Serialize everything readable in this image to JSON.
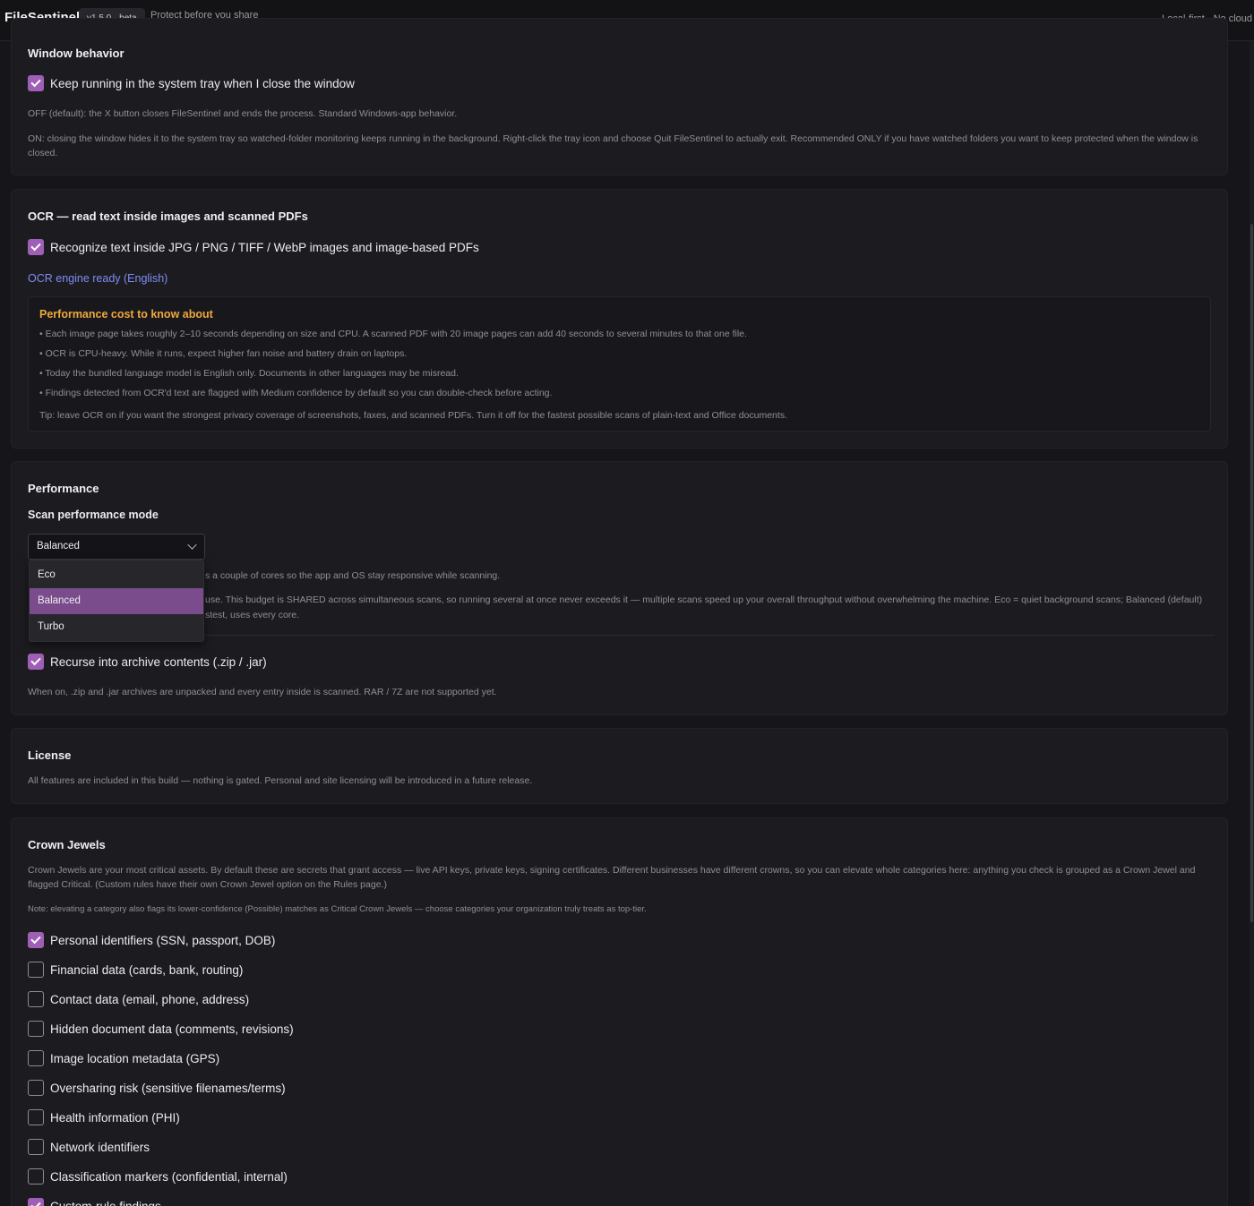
{
  "header": {
    "app_name": "FileSentinel",
    "version": "v1.5.0 · beta",
    "tagline": "Protect before you share",
    "right_text": "Local-first · No cloud"
  },
  "window_behavior": {
    "title": "Window behavior",
    "tray_label": "Keep running in the system tray when I close the window",
    "tray_checked": true,
    "desc_off": "OFF (default): the X button closes FileSentinel and ends the process. Standard Windows-app behavior.",
    "desc_on": "ON: closing the window hides it to the system tray so watched-folder monitoring keeps running in the background. Right-click the tray icon and choose Quit FileSentinel to actually exit. Recommended ONLY if you have watched folders you want to keep protected when the window is closed."
  },
  "ocr": {
    "title": "OCR — read text inside images and scanned PDFs",
    "enable_label": "Recognize text inside JPG / PNG / TIFF / WebP images and image-based PDFs",
    "enable_checked": true,
    "status": "OCR engine ready (English)",
    "callout_title": "Performance cost to know about",
    "bullets": [
      "• Each image page takes roughly 2–10 seconds depending on size and CPU. A scanned PDF with 20 image pages can add 40 seconds to several minutes to that one file.",
      "• OCR is CPU-heavy. While it runs, expect higher fan noise and battery drain on laptops.",
      "• Today the bundled language model is English only. Documents in other languages may be misread.",
      "• Findings detected from OCR'd text are flagged with Medium confidence by default so you can double-check before acting."
    ],
    "tip": "Tip: leave OCR on if you want the strongest privacy coverage of screenshots, faxes, and scanned PDFs. Turn it off for the fastest possible scans of plain-text and Office documents."
  },
  "performance": {
    "title": "Performance",
    "mode_label": "Scan performance mode",
    "selected": "Balanced",
    "options": [
      "Eco",
      "Balanced",
      "Turbo"
    ],
    "desc_line1_visible": "s a couple of cores so the app and OS stay responsive while scanning.",
    "desc_line2_visible": "use. This budget is SHARED across simultaneous scans, so running several at once never exceeds it — multiple scans speed up your overall throughput without overwhelming the machine. Eco = quiet background scans; Balanced (default)",
    "desc_line3_visible": "stest, uses every core.",
    "archive_label": "Recurse into archive contents (.zip / .jar)",
    "archive_checked": true,
    "archive_desc": "When on, .zip and .jar archives are unpacked and every entry inside is scanned. RAR / 7Z are not supported yet."
  },
  "license": {
    "title": "License",
    "desc": "All features are included in this build — nothing is gated. Personal and site licensing will be introduced in a future release."
  },
  "crown_jewels": {
    "title": "Crown Jewels",
    "desc": "Crown Jewels are your most critical assets. By default these are secrets that grant access — live API keys, private keys, signing certificates. Different businesses have different crowns, so you can elevate whole categories here: anything you check is grouped as a Crown Jewel and flagged Critical. (Custom rules have their own Crown Jewel option on the Rules page.)",
    "note": "Note: elevating a category also flags its lower-confidence (Possible) matches as Critical Crown Jewels — choose categories your organization truly treats as top-tier.",
    "categories": [
      {
        "label": "Personal identifiers (SSN, passport, DOB)",
        "checked": true
      },
      {
        "label": "Financial data (cards, bank, routing)",
        "checked": false
      },
      {
        "label": "Contact data (email, phone, address)",
        "checked": false
      },
      {
        "label": "Hidden document data (comments, revisions)",
        "checked": false
      },
      {
        "label": "Image location metadata (GPS)",
        "checked": false
      },
      {
        "label": "Oversharing risk (sensitive filenames/terms)",
        "checked": false
      },
      {
        "label": "Health information (PHI)",
        "checked": false
      },
      {
        "label": "Network identifiers",
        "checked": false
      },
      {
        "label": "Classification markers (confidential, internal)",
        "checked": false
      },
      {
        "label": "Custom-rule findings",
        "checked": true
      }
    ]
  },
  "colors": {
    "accent": "#a05fb6",
    "selected_option": "#7a4c8c",
    "warning_title": "#f0a73c",
    "status_blue": "#7f8cf5"
  }
}
